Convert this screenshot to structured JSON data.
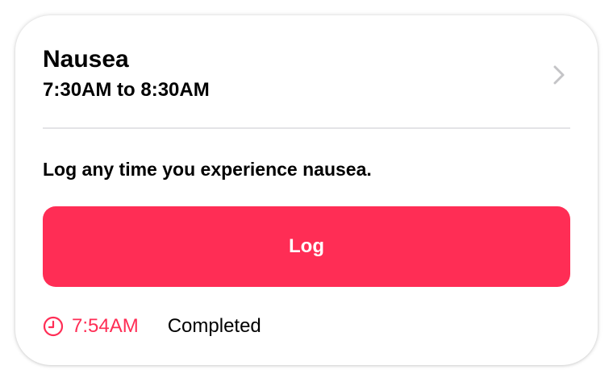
{
  "card": {
    "title": "Nausea",
    "time_range": "7:30AM to 8:30AM",
    "description": "Log any time you experience nausea.",
    "button_label": "Log",
    "footer": {
      "time": "7:54AM",
      "status": "Completed"
    }
  },
  "icons": {
    "chevron": "chevron-right-icon",
    "clock": "clock-icon"
  },
  "colors": {
    "accent": "#ff2d55",
    "divider": "#e3e3e6",
    "chevron": "#c4c4c7"
  }
}
